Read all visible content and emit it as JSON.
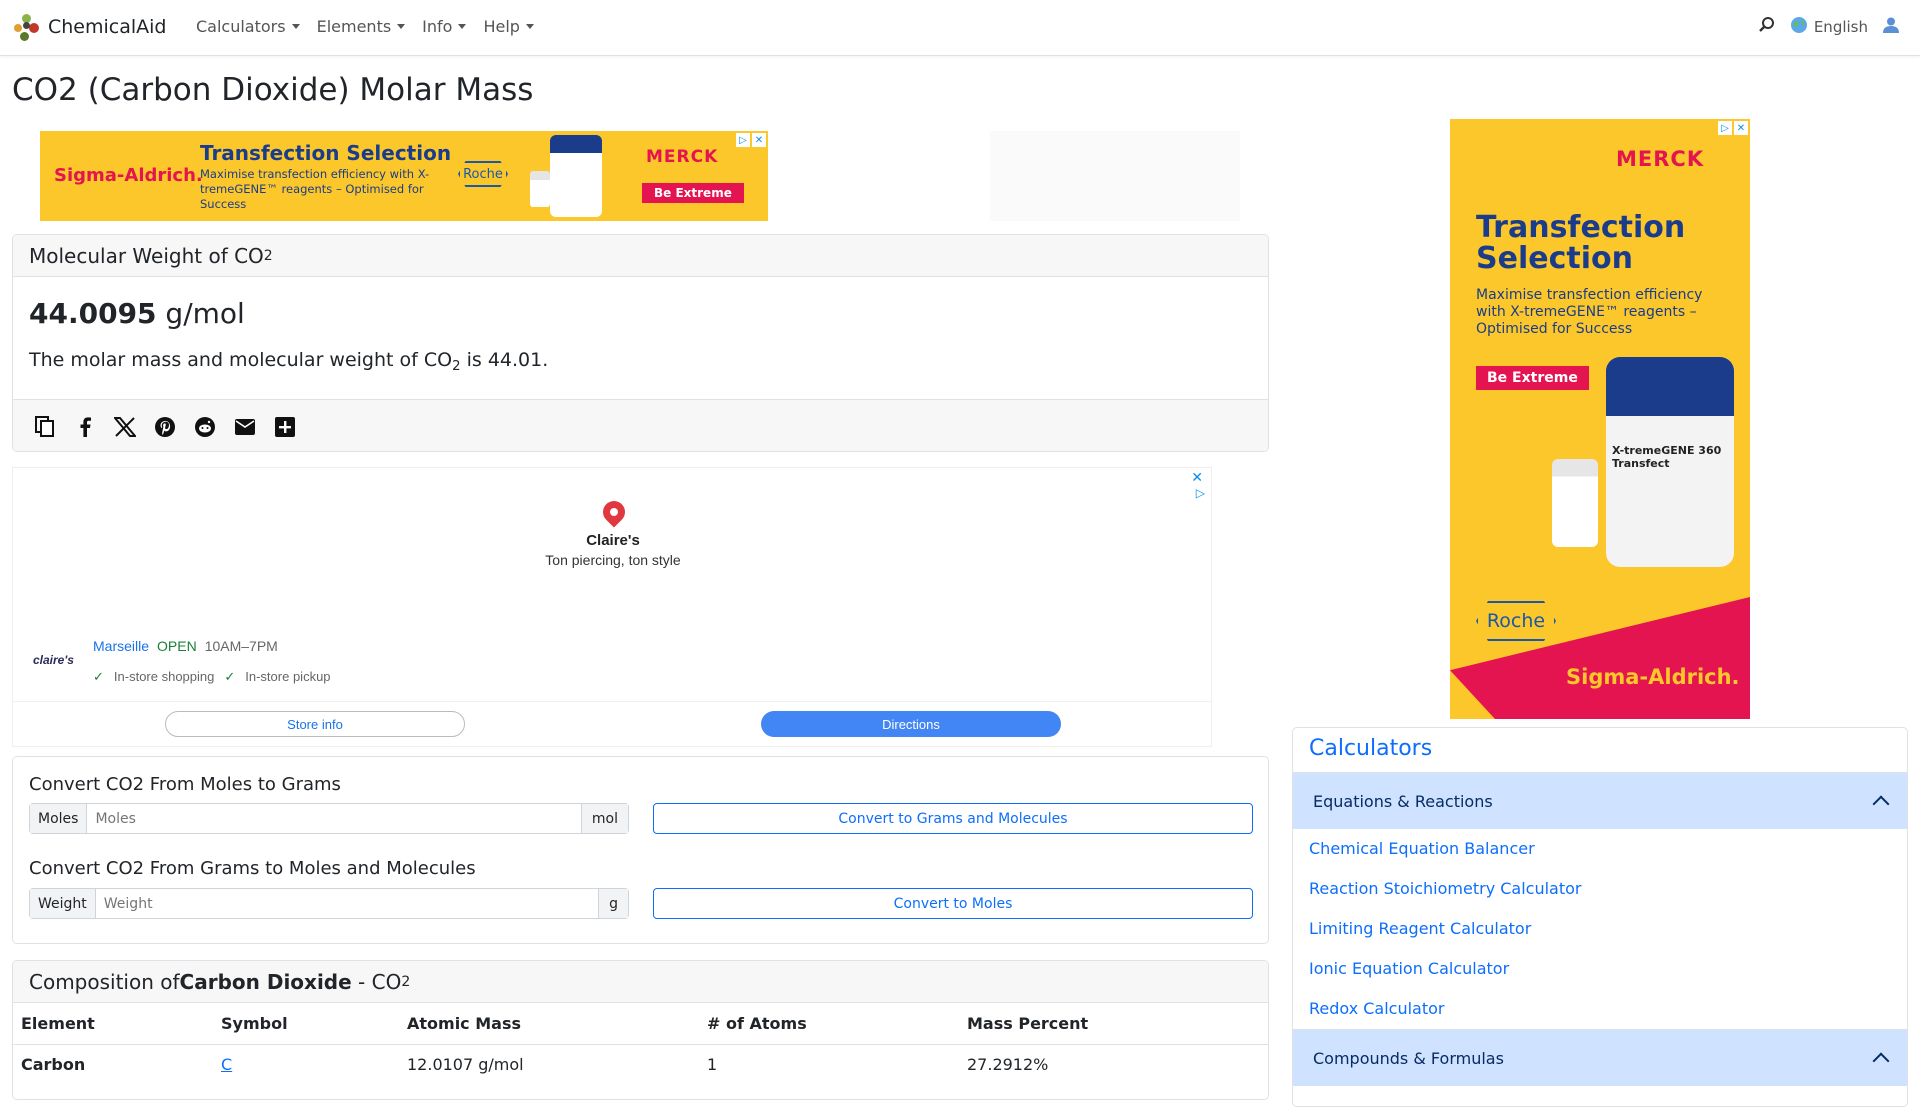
{
  "navbar": {
    "brand": "ChemicalAid",
    "menu": [
      "Calculators",
      "Elements",
      "Info",
      "Help"
    ],
    "language": "English"
  },
  "page": {
    "title": "CO2 (Carbon Dioxide) Molar Mass"
  },
  "ad_banner": {
    "sigma": "Sigma-Aldrich.",
    "headline": "Transfection Selection",
    "body": "Maximise transfection efficiency with X-tremeGENE™ reagents – Optimised for Success",
    "roche": "Roche",
    "merck": "MERCK",
    "button": "Be Extreme"
  },
  "ad_side": {
    "merck": "MERCK",
    "headline": "Transfection Selection",
    "body": "Maximise transfection efficiency with X-tremeGENE™ reagents – Optimised for Success",
    "button": "Be Extreme",
    "jar_label": "X-tremeGENE 360 Transfect",
    "roche": "Roche",
    "sigma": "Sigma-Aldrich."
  },
  "molecular_weight": {
    "header_prefix": "Molecular Weight of CO",
    "header_sub": "2",
    "value": "44.0095",
    "unit": " g/mol",
    "desc_prefix": "The molar mass and molecular weight of CO",
    "desc_sub": "2",
    "desc_suffix": " is 44.01."
  },
  "share_icons": [
    "copy-icon",
    "facebook-icon",
    "x-icon",
    "pinterest-icon",
    "reddit-icon",
    "email-icon",
    "plus-icon"
  ],
  "map_ad": {
    "name": "Claire's",
    "tagline": "Ton piercing, ton style",
    "logo": "claire's",
    "city": "Marseille",
    "status": "OPEN",
    "hours": "10AM–7PM",
    "feature1": "In-store shopping",
    "feature2": "In-store pickup",
    "store_info": "Store info",
    "directions": "Directions"
  },
  "converter": {
    "moles_title": "Convert CO2 From Moles to Grams",
    "moles_label": "Moles",
    "moles_placeholder": "Moles",
    "moles_unit": "mol",
    "moles_button": "Convert to Grams and Molecules",
    "grams_title": "Convert CO2 From Grams to Moles and Molecules",
    "grams_label": "Weight",
    "grams_placeholder": "Weight",
    "grams_unit": "g",
    "grams_button": "Convert to Moles"
  },
  "composition": {
    "prefix": "Composition of ",
    "name": "Carbon Dioxide",
    "mid": " - CO",
    "sub": "2",
    "headers": [
      "Element",
      "Symbol",
      "Atomic Mass",
      "# of Atoms",
      "Mass Percent"
    ],
    "rows": [
      {
        "element": "Carbon",
        "symbol": "C",
        "atomic_mass": "12.0107 g/mol",
        "atoms": "1",
        "percent": "27.2912%"
      }
    ]
  },
  "calculators": {
    "title": "Calculators",
    "section1": "Equations & Reactions",
    "links": [
      "Chemical Equation Balancer",
      "Reaction Stoichiometry Calculator",
      "Limiting Reagent Calculator",
      "Ionic Equation Calculator",
      "Redox Calculator"
    ],
    "section2": "Compounds & Formulas"
  },
  "colors": {
    "link": "#0d6efd",
    "accordion_active": "#cfe2ff",
    "ad_yellow": "#fcc72a",
    "ad_pink": "#e41450"
  }
}
